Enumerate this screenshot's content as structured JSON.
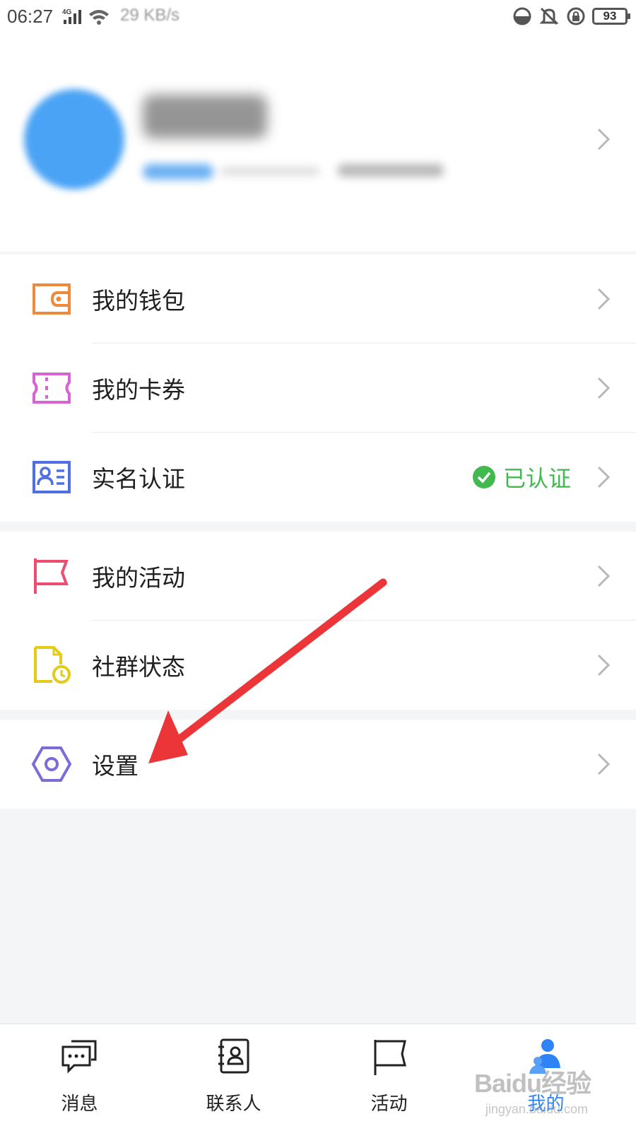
{
  "status_bar": {
    "time": "06:27",
    "network": "4G",
    "speed": "29 KB/s",
    "battery": "93"
  },
  "profile": {
    "name_hidden": true
  },
  "menu": {
    "wallet": "我的钱包",
    "coupons": "我的卡券",
    "real_name": "实名认证",
    "real_name_status": "已认证",
    "activities": "我的活动",
    "community": "社群状态",
    "settings": "设置"
  },
  "colors": {
    "wallet_icon": "#f0893a",
    "coupons_icon": "#d863d4",
    "real_name_icon": "#4d6fe3",
    "verified": "#42b94f",
    "activities_icon": "#ec4e72",
    "community_icon": "#e2cb19",
    "settings_icon": "#7e6ad9",
    "annotation_arrow": "#ec3538",
    "active_tab": "#2f84f5"
  },
  "nav": {
    "messages": "消息",
    "contacts": "联系人",
    "activities": "活动",
    "mine": "我的"
  },
  "watermark": {
    "brand": "Baidu经验",
    "url": "jingyan.baidu.com"
  }
}
